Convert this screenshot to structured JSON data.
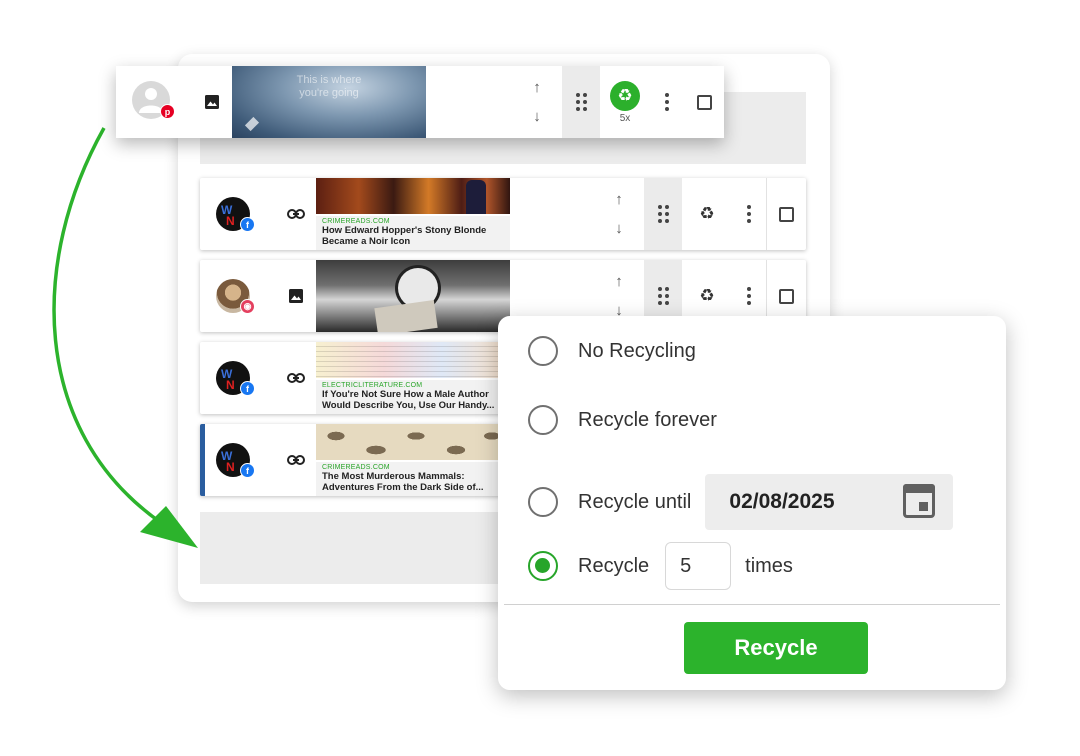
{
  "floating_post": {
    "thumb_text_line1": "This is where",
    "thumb_text_line2": "you're going",
    "recycle_count": "5x"
  },
  "posts": [
    {
      "source": "CRIMEREADS.COM",
      "headline_line1": "How Edward Hopper's Stony Blonde",
      "headline_line2": "Became a Noir Icon"
    },
    {
      "source": "",
      "headline_line1": "",
      "headline_line2": ""
    },
    {
      "source": "ELECTRICLITERATURE.COM",
      "headline_line1": "If You're Not Sure How a Male Author",
      "headline_line2": "Would Describe You, Use Our Handy..."
    },
    {
      "source": "CRIMEREADS.COM",
      "headline_line1": "The Most Murderous Mammals:",
      "headline_line2": "Adventures From the Dark Side of..."
    }
  ],
  "popover": {
    "option_none": "No Recycling",
    "option_forever": "Recycle forever",
    "option_until": "Recycle until",
    "until_date": "02/08/2025",
    "option_times_prefix": "Recycle",
    "times_value": "5",
    "option_times_suffix": "times",
    "button_label": "Recycle",
    "selected_option": "times"
  },
  "icons": {
    "up": "↑",
    "down": "↓",
    "recycle": "♻"
  },
  "colors": {
    "accent_green": "#2cb32c",
    "selected_row_bar": "#2a5d9f",
    "facebook": "#1877f2",
    "instagram": "#e4405f",
    "pinterest": "#e60023"
  }
}
